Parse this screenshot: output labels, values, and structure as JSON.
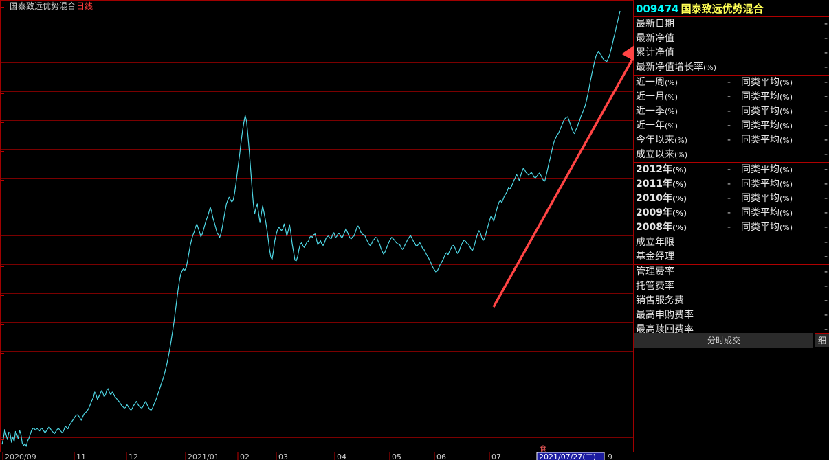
{
  "chart": {
    "title": "国泰致远优势混合",
    "period": "日线",
    "cursor_date": "2021/07/27(二)",
    "cursor_marker": "食",
    "edge_label": "9",
    "x_ticks": [
      "2020/09",
      "11",
      "12",
      "2021/01",
      "02",
      "03",
      "04",
      "05",
      "06",
      "07"
    ],
    "colors": {
      "line": "#4fd8e6",
      "grid": "#7a0000",
      "arrow": "#ff4444"
    }
  },
  "chart_data": {
    "type": "line",
    "title": "国泰致远优势混合",
    "xlabel": "",
    "ylabel": "",
    "grid": true,
    "series": [
      {
        "name": "",
        "values": [
          0.5,
          1.4,
          2.7,
          1.9,
          1.2,
          2.3,
          2.1,
          0.8,
          1.6,
          0.9,
          2.4,
          2.0,
          1.3,
          2.6,
          2.0,
          0.7,
          0.3,
          0.6,
          0.2,
          1.0,
          1.4,
          2.0,
          2.6,
          2.9,
          2.8,
          2.6,
          2.9,
          2.7,
          2.5,
          2.9,
          2.8,
          2.5,
          2.2,
          2.5,
          2.8,
          3.1,
          2.8,
          2.5,
          2.3,
          2.1,
          2.4,
          2.7,
          2.9,
          2.6,
          2.4,
          2.2,
          2.6,
          3.2,
          3.0,
          2.8,
          3.3,
          3.6,
          3.9,
          4.2,
          4.5,
          4.8,
          4.9,
          4.7,
          4.4,
          4.1,
          4.6,
          5.0,
          5.2,
          5.4,
          5.7,
          6.1,
          6.6,
          7.1,
          7.5,
          8.3,
          7.9,
          7.2,
          7.6,
          8.0,
          8.5,
          8.2,
          7.6,
          7.9,
          8.6,
          8.8,
          8.2,
          7.9,
          8.3,
          8.0,
          7.6,
          7.4,
          7.1,
          6.9,
          6.6,
          6.3,
          6.1,
          5.9,
          6.0,
          6.4,
          6.1,
          5.8,
          5.6,
          5.9,
          6.3,
          6.6,
          6.9,
          6.5,
          6.2,
          6.0,
          5.9,
          6.2,
          6.6,
          6.9,
          6.4,
          6.0,
          5.7,
          5.6,
          5.9,
          6.4,
          6.9,
          7.4,
          8.0,
          8.6,
          9.2,
          9.8,
          10.4,
          11.1,
          11.9,
          12.8,
          13.8,
          14.9,
          16.1,
          17.4,
          18.8,
          20.4,
          22.0,
          23.5,
          24.9,
          25.9,
          26.4,
          26.7,
          26.5,
          26.8,
          27.8,
          29.0,
          30.1,
          31.0,
          31.7,
          32.2,
          32.9,
          33.4,
          32.8,
          32.2,
          31.5,
          31.9,
          32.6,
          33.3,
          34.0,
          34.5,
          35.2,
          35.9,
          35.2,
          34.3,
          33.6,
          32.9,
          32.1,
          31.8,
          31.4,
          32.0,
          33.0,
          34.2,
          35.3,
          36.4,
          36.9,
          37.4,
          37.0,
          36.7,
          36.9,
          37.9,
          39.3,
          40.9,
          42.5,
          44.0,
          45.8,
          47.3,
          48.6,
          49.6,
          48.7,
          46.7,
          44.3,
          41.6,
          39.0,
          36.5,
          34.9,
          35.8,
          36.4,
          34.9,
          33.6,
          34.9,
          36.1,
          35.1,
          34.0,
          32.8,
          31.3,
          29.7,
          28.5,
          28.1,
          29.4,
          30.9,
          31.8,
          32.5,
          32.9,
          32.7,
          32.4,
          32.7,
          33.4,
          32.6,
          31.6,
          32.4,
          33.3,
          32.0,
          30.4,
          29.2,
          28.0,
          27.9,
          28.5,
          29.6,
          30.4,
          30.6,
          30.1,
          29.9,
          30.3,
          30.7,
          30.8,
          31.4,
          31.6,
          31.4,
          31.8,
          31.9,
          31.1,
          30.3,
          30.6,
          30.9,
          30.4,
          30.2,
          30.6,
          31.2,
          31.5,
          31.6,
          31.3,
          31.2,
          31.8,
          32.1,
          31.4,
          31.5,
          31.9,
          32.0,
          31.6,
          31.3,
          31.7,
          32.2,
          32.7,
          32.2,
          31.7,
          31.3,
          31.2,
          31.5,
          31.6,
          32.2,
          32.8,
          33.1,
          32.7,
          32.2,
          31.9,
          31.8,
          31.7,
          31.2,
          30.8,
          30.4,
          30.2,
          30.4,
          30.9,
          31.1,
          31.4,
          31.3,
          30.8,
          30.4,
          29.8,
          29.3,
          28.9,
          29.2,
          29.7,
          30.2,
          30.7,
          31.1,
          31.4,
          31.2,
          31.0,
          30.7,
          30.5,
          30.4,
          30.3,
          29.9,
          29.6,
          29.9,
          30.3,
          30.7,
          31.1,
          31.4,
          31.7,
          31.3,
          30.9,
          30.6,
          30.2,
          30.1,
          30.4,
          30.6,
          30.2,
          29.8,
          29.6,
          29.2,
          28.8,
          28.5,
          28.1,
          27.7,
          27.2,
          26.8,
          26.5,
          26.2,
          26.4,
          26.8,
          27.3,
          27.6,
          28.0,
          28.4,
          28.9,
          29.1,
          28.8,
          29.3,
          29.7,
          30.1,
          30.2,
          29.9,
          29.4,
          29.0,
          29.2,
          29.8,
          30.3,
          30.7,
          31.0,
          30.8,
          30.5,
          30.4,
          30.1,
          29.7,
          29.4,
          29.8,
          30.5,
          31.3,
          31.9,
          32.4,
          32.1,
          31.4,
          30.9,
          31.2,
          31.8,
          32.6,
          33.3,
          34.0,
          34.6,
          34.3,
          33.8,
          34.6,
          35.4,
          36.1,
          36.7,
          36.9,
          36.6,
          37.1,
          37.6,
          37.9,
          38.3,
          38.8,
          38.6,
          38.9,
          39.4,
          39.9,
          40.3,
          40.8,
          40.4,
          39.9,
          40.6,
          41.2,
          41.7,
          41.5,
          41.1,
          40.9,
          40.7,
          40.9,
          41.1,
          40.8,
          40.4,
          40.3,
          40.5,
          40.8,
          41.0,
          40.7,
          40.3,
          39.9,
          39.8,
          40.6,
          41.5,
          42.4,
          43.2,
          44.1,
          45.0,
          45.7,
          46.2,
          46.6,
          46.9,
          47.3,
          47.8,
          48.3,
          48.8,
          49.1,
          49.3,
          49.4,
          48.9,
          48.3,
          47.7,
          47.2,
          46.9,
          47.4,
          47.8,
          48.4,
          48.9,
          49.5,
          50.0,
          50.5,
          51.0,
          51.8,
          52.7,
          53.7,
          54.8,
          55.8,
          56.7,
          57.6,
          58.4,
          58.9,
          59.1,
          58.9,
          58.6,
          58.2,
          57.9,
          57.8,
          57.6,
          58.0,
          58.5,
          59.2,
          60.0,
          60.9,
          61.7,
          62.6,
          63.5,
          64.3,
          65.2
        ]
      }
    ]
  },
  "panel": {
    "code": "009474",
    "name": "国泰致远优势混合",
    "info_rows": [
      {
        "label": "最新日期",
        "value": "-"
      },
      {
        "label": "最新净值",
        "value": "-"
      },
      {
        "label": "累计净值",
        "value": "-"
      },
      {
        "label": "最新净值增长率",
        "pct": "(%)",
        "value": "-"
      }
    ],
    "period_rows": [
      {
        "label": "近一周",
        "pct": "(%)",
        "dash": "-",
        "avg": "同类平均",
        "avg_pct": "(%)",
        "value": "-"
      },
      {
        "label": "近一月",
        "pct": "(%)",
        "dash": "-",
        "avg": "同类平均",
        "avg_pct": "(%)",
        "value": "-"
      },
      {
        "label": "近一季",
        "pct": "(%)",
        "dash": "-",
        "avg": "同类平均",
        "avg_pct": "(%)",
        "value": "-"
      },
      {
        "label": "近一年",
        "pct": "(%)",
        "dash": "-",
        "avg": "同类平均",
        "avg_pct": "(%)",
        "value": "-"
      },
      {
        "label": "今年以来",
        "pct": "(%)",
        "dash": "-",
        "avg": "同类平均",
        "avg_pct": "(%)",
        "value": "-"
      },
      {
        "label": "成立以来",
        "pct": "(%)",
        "value": "-"
      }
    ],
    "year_rows": [
      {
        "label": "2012年",
        "pct": "(%)",
        "dash": "-",
        "avg": "同类平均",
        "avg_pct": "(%)",
        "value": "-"
      },
      {
        "label": "2011年",
        "pct": "(%)",
        "dash": "-",
        "avg": "同类平均",
        "avg_pct": "(%)",
        "value": "-"
      },
      {
        "label": "2010年",
        "pct": "(%)",
        "dash": "-",
        "avg": "同类平均",
        "avg_pct": "(%)",
        "value": "-"
      },
      {
        "label": "2009年",
        "pct": "(%)",
        "dash": "-",
        "avg": "同类平均",
        "avg_pct": "(%)",
        "value": "-"
      },
      {
        "label": "2008年",
        "pct": "(%)",
        "dash": "-",
        "avg": "同类平均",
        "avg_pct": "(%)",
        "value": "-"
      }
    ],
    "meta_rows": [
      {
        "label": "成立年限",
        "value": "-"
      },
      {
        "label": "基金经理",
        "value": "-"
      }
    ],
    "fee_rows": [
      {
        "label": "管理费率",
        "value": "-"
      },
      {
        "label": "托管费率",
        "value": "-"
      },
      {
        "label": "销售服务费",
        "value": "-"
      },
      {
        "label": "最高申购费率",
        "value": "-"
      },
      {
        "label": "最高赎回费率",
        "value": "-"
      }
    ],
    "tab_main": "分时成交",
    "tab_detail": "细"
  }
}
